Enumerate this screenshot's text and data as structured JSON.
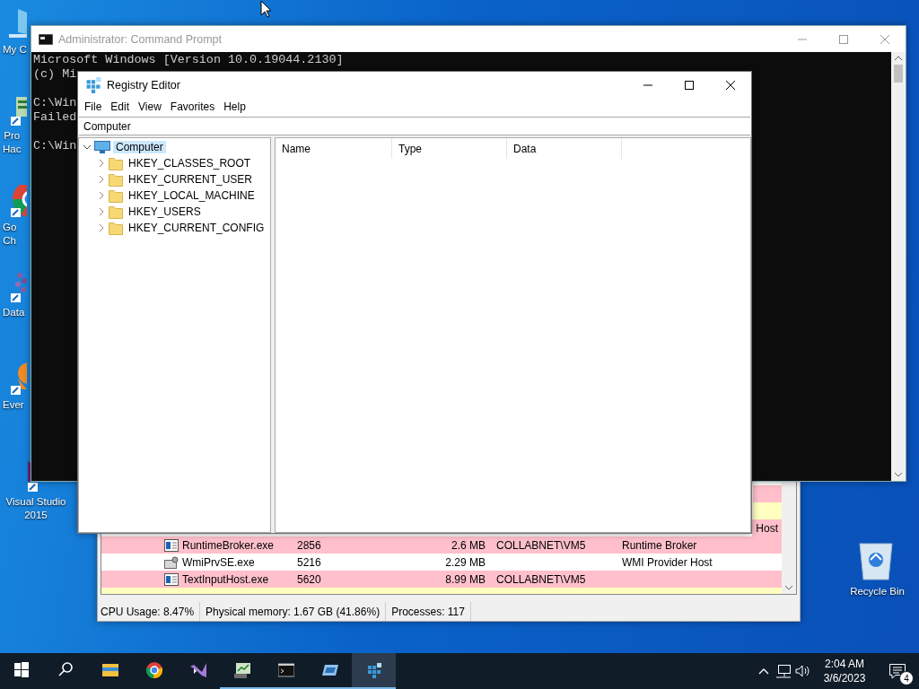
{
  "desktop_icons": [
    {
      "kind": "computer",
      "lines": [
        "My C"
      ]
    },
    {
      "kind": "chart",
      "lines": [
        "Pro",
        "Hac"
      ]
    },
    {
      "kind": "browser",
      "lines": [
        "Go",
        "Ch"
      ]
    },
    {
      "kind": "dots",
      "lines": [
        "Data"
      ]
    },
    {
      "kind": "orange",
      "lines": [
        "Ever"
      ]
    },
    {
      "kind": "studio",
      "lines": [
        "Visual Studio",
        "2015"
      ]
    }
  ],
  "recycle_bin": {
    "label": "Recycle Bin"
  },
  "task_manager": {
    "rows": [
      {
        "kind": "blank",
        "color": "#ffc0cb"
      },
      {
        "kind": "blank",
        "color": "#ffffc0"
      },
      {
        "kind": "partial",
        "color": "#ffc0cb",
        "description": "Host"
      },
      {
        "kind": "app",
        "color": "#ffc0cb",
        "name": "RuntimeBroker.exe",
        "pid": "2856",
        "memory": "2.6 MB",
        "user": "COLLABNET\\VM5",
        "description": "Runtime Broker"
      },
      {
        "kind": "service",
        "color": "#ffffff",
        "name": "WmiPrvSE.exe",
        "pid": "5216",
        "memory": "2.29 MB",
        "user": "",
        "description": "WMI Provider Host"
      },
      {
        "kind": "app",
        "color": "#ffc0cb",
        "name": "TextInputHost.exe",
        "pid": "5620",
        "memory": "8.99 MB",
        "user": "COLLABNET\\VM5",
        "description": ""
      },
      {
        "kind": "cut",
        "color": "#ffffc0"
      }
    ],
    "status_bar": [
      "CPU Usage: 8.47%",
      "Physical memory: 1.67 GB (41.86%)",
      "Processes: 117"
    ]
  },
  "cmd_window": {
    "title": "Administrator:  Command Prompt",
    "blocks": [
      [
        "Microsoft Windows [Version 10.0.19044.2130]",
        "(c) Mi"
      ],
      [
        "C:\\Win",
        "Failed"
      ],
      [
        "C:\\Win"
      ]
    ]
  },
  "regedit": {
    "title": "Registry Editor",
    "menu": [
      "File",
      "Edit",
      "View",
      "Favorites",
      "Help"
    ],
    "address": "Computer",
    "tree": [
      {
        "label": "Computer",
        "expanded": true,
        "selected": true,
        "children": [
          {
            "label": "HKEY_CLASSES_ROOT",
            "expanded": false,
            "selected": false
          },
          {
            "label": "HKEY_CURRENT_USER",
            "expanded": false,
            "selected": false
          },
          {
            "label": "HKEY_LOCAL_MACHINE",
            "expanded": false,
            "selected": false
          },
          {
            "label": "HKEY_USERS",
            "expanded": false,
            "selected": false
          },
          {
            "label": "HKEY_CURRENT_CONFIG",
            "expanded": false,
            "selected": false
          }
        ]
      }
    ],
    "columns": [
      "Name",
      "Type",
      "Data"
    ]
  },
  "taskbar": {
    "apps": [
      {
        "kind": "start",
        "running": false,
        "active": false
      },
      {
        "kind": "search",
        "running": false,
        "active": false
      },
      {
        "kind": "folder",
        "running": false,
        "active": false
      },
      {
        "kind": "browser",
        "running": false,
        "active": false
      },
      {
        "kind": "studio",
        "running": false,
        "active": false
      },
      {
        "kind": "chart",
        "running": true,
        "active": false
      },
      {
        "kind": "terminal",
        "running": true,
        "active": false
      },
      {
        "kind": "window",
        "running": true,
        "active": false
      },
      {
        "kind": "registry",
        "running": true,
        "active": true
      }
    ],
    "clock": {
      "time": "2:04 AM",
      "date": "3/6/2023"
    },
    "notifications": "4"
  }
}
